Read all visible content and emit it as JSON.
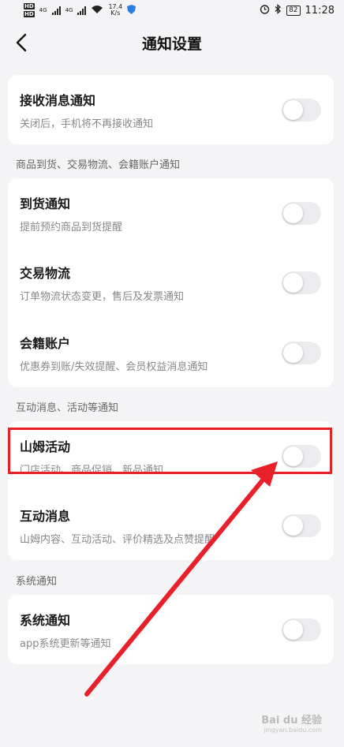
{
  "status_bar": {
    "sim1": "HD",
    "sim2": "HD",
    "net1": "4G",
    "net2": "4G",
    "speed_value": "17.4",
    "speed_unit": "K/s",
    "battery": "82",
    "time": "11:28"
  },
  "header": {
    "title": "通知设置"
  },
  "main_toggle": {
    "title": "接收消息通知",
    "desc": "关闭后，手机将不再接收通知",
    "enabled": false
  },
  "sections": [
    {
      "label": "商品到货、交易物流、会籍账户通知",
      "items": [
        {
          "title": "到货通知",
          "desc": "提前预约商品到货提醒",
          "enabled": false
        },
        {
          "title": "交易物流",
          "desc": "订单物流状态变更，售后及发票通知",
          "enabled": false
        },
        {
          "title": "会籍账户",
          "desc": "优惠券到账/失效提醒、会员权益消息通知",
          "enabled": false
        }
      ]
    },
    {
      "label": "互动消息、活动等通知",
      "items": [
        {
          "title": "山姆活动",
          "desc": "门店活动、商品促销、新品通知",
          "enabled": false
        },
        {
          "title": "互动消息",
          "desc": "山姆内容、互动活动、评价精选及点赞提醒",
          "enabled": false
        }
      ]
    },
    {
      "label": "系统通知",
      "items": [
        {
          "title": "系统通知",
          "desc": "app系统更新等通知",
          "enabled": false
        }
      ]
    }
  ],
  "colors": {
    "background": "#f4f4f6",
    "card": "#ffffff",
    "toggle_off": "#ececee",
    "annotation_red": "#e8202a"
  },
  "watermark": {
    "brand": "Bai du 经验",
    "url": "jingyan.baidu.com"
  }
}
